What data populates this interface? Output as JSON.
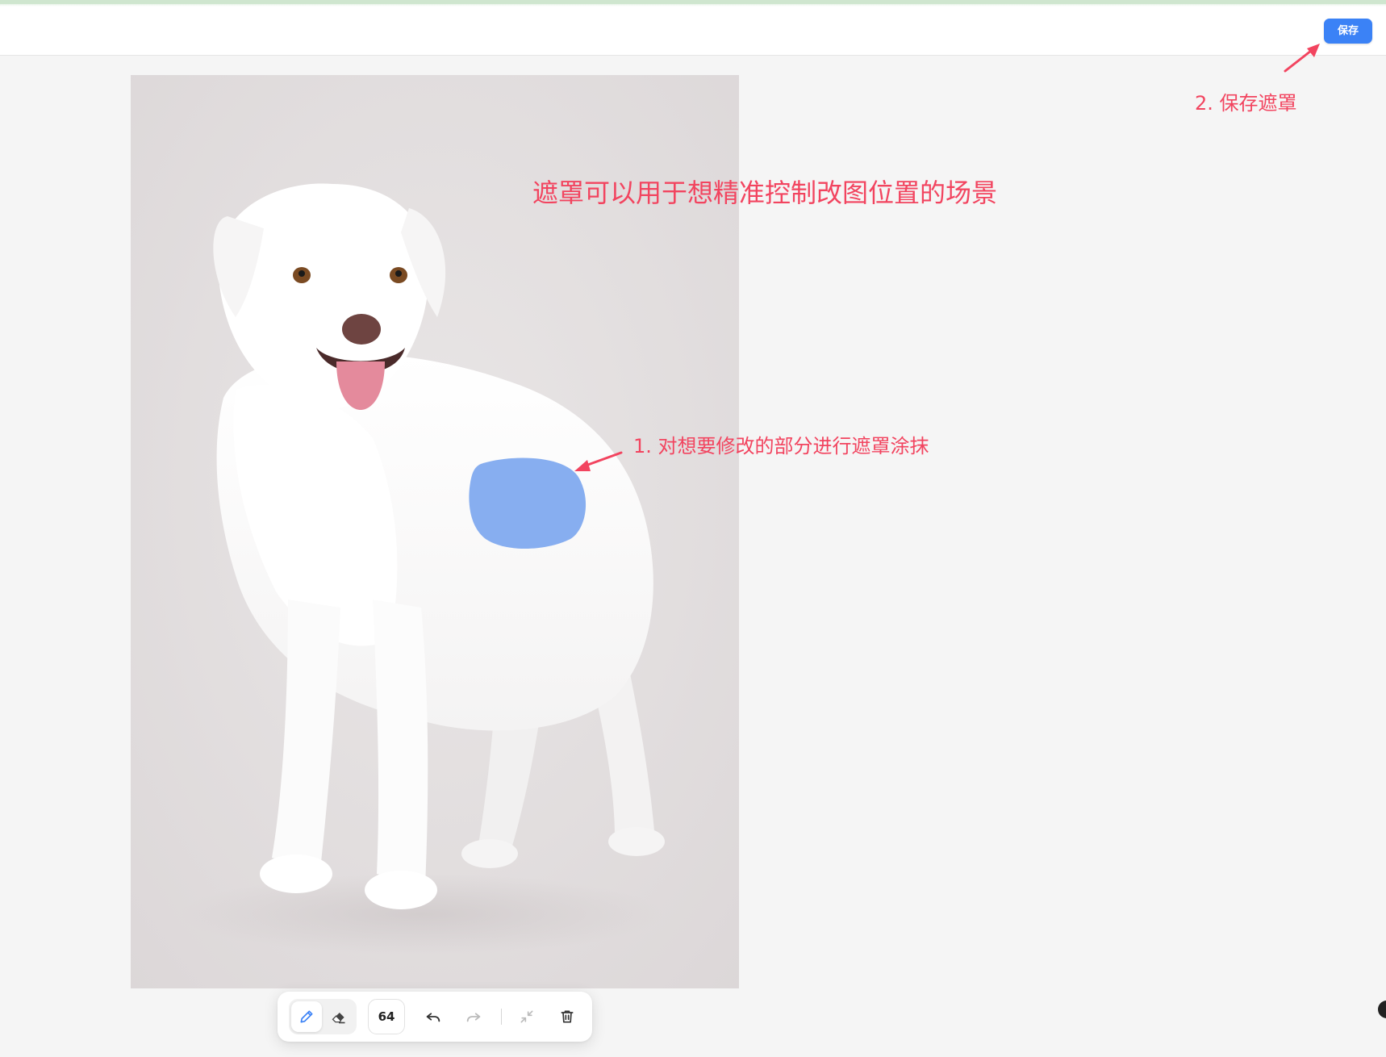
{
  "header": {
    "save_label": "保存"
  },
  "annotations": {
    "headline": "遮罩可以用于想精准控制改图位置的场景",
    "step1": "1. 对想要修改的部分进行遮罩涂抹",
    "step2": "2. 保存遮罩"
  },
  "colors": {
    "primary": "#3b82f6",
    "annotation": "#f2445f",
    "mask": "#87aef0",
    "canvas_background": "#f5f5f5"
  },
  "toolbar": {
    "active_tool": "brush",
    "brush_size": "64",
    "icons": [
      "pencil-icon",
      "eraser-icon",
      "undo-icon",
      "redo-icon",
      "collapse-icon",
      "trash-icon"
    ]
  }
}
